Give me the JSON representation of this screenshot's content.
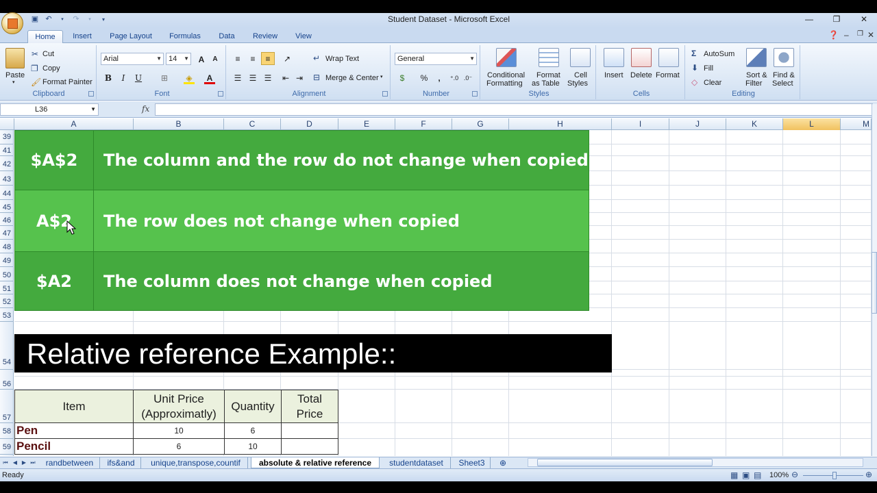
{
  "window": {
    "title": "Student Dataset  -  Microsoft Excel",
    "controls": [
      "—",
      "❐",
      "✕"
    ]
  },
  "tabs": [
    "Home",
    "Insert",
    "Page Layout",
    "Formulas",
    "Data",
    "Review",
    "View"
  ],
  "ribbon": {
    "clipboard": {
      "paste": "Paste",
      "cut": "Cut",
      "copy": "Copy",
      "format_painter": "Format Painter",
      "label": "Clipboard"
    },
    "font": {
      "name": "Arial",
      "size": "14",
      "bold": "B",
      "italic": "I",
      "underline": "U",
      "label": "Font",
      "grow": "A",
      "shrink": "A"
    },
    "alignment": {
      "wrap_text": "Wrap Text",
      "merge_center": "Merge & Center",
      "label": "Alignment"
    },
    "number": {
      "format": "General",
      "percent": "%",
      "comma": ",",
      "label": "Number"
    },
    "styles": {
      "conditional": "Conditional",
      "conditional2": "Formatting",
      "format_as": "Format",
      "format_as2": "as Table",
      "cell": "Cell",
      "cell2": "Styles",
      "label": "Styles"
    },
    "cells": {
      "insert": "Insert",
      "delete": "Delete",
      "format": "Format",
      "label": "Cells"
    },
    "editing": {
      "autosum": "AutoSum",
      "fill": "Fill",
      "clear": "Clear",
      "sort": "Sort &",
      "sort2": "Filter",
      "find": "Find &",
      "find2": "Select",
      "label": "Editing"
    }
  },
  "formula_bar": {
    "name_box": "L36",
    "fx": "fx",
    "content": ""
  },
  "columns": [
    "A",
    "B",
    "C",
    "D",
    "E",
    "F",
    "G",
    "H",
    "I",
    "J",
    "K",
    "L",
    "M"
  ],
  "selected_column": "L",
  "rows": [
    "39",
    "41",
    "42",
    "43",
    "44",
    "45",
    "46",
    "47",
    "48",
    "49",
    "50",
    "51",
    "52",
    "53",
    "54",
    "56",
    "57",
    "58",
    "59"
  ],
  "green_block": [
    {
      "ref": "$A$2",
      "desc": "The column and the row do not change when copied"
    },
    {
      "ref": "A$2",
      "desc": "The row does not change when copied"
    },
    {
      "ref": "$A2",
      "desc": "The column does not change when copied"
    }
  ],
  "banner": "Relative reference Example::",
  "table": {
    "headers": [
      "Item",
      "Unit Price\n(Approximatly)",
      "Quantity",
      "Total\nPrice"
    ],
    "header_lines": [
      [
        "Item"
      ],
      [
        "Unit Price",
        "(Approximatly)"
      ],
      [
        "Quantity"
      ],
      [
        "Total",
        "Price"
      ]
    ],
    "rows": [
      {
        "item": "Pen",
        "price": "10",
        "qty": "6",
        "total": ""
      },
      {
        "item": "Pencil",
        "price": "6",
        "qty": "10",
        "total": ""
      }
    ]
  },
  "sheets": [
    "randbetween",
    "ifs&and",
    "unique,transpose,countif",
    "absolute & relative reference",
    "studentdataset",
    "Sheet3"
  ],
  "active_sheet": "absolute & relative reference",
  "status": {
    "ready": "Ready",
    "zoom": "100%"
  },
  "colors": {
    "green": "#44aa3e",
    "header_fill": "#ebf1de",
    "item_text": "#5a1010"
  }
}
